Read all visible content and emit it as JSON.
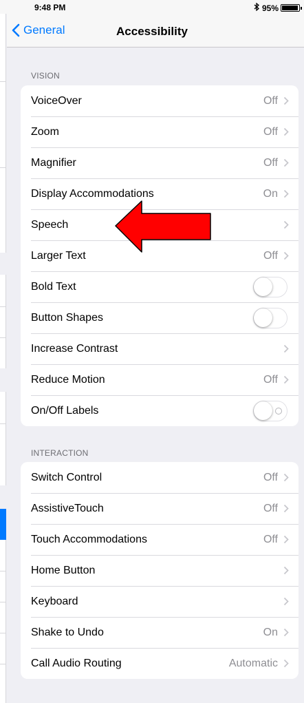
{
  "status_bar": {
    "time": "9:48 PM",
    "bluetooth_icon": "bluetooth-icon",
    "battery": "95%",
    "battery_level": 0.95
  },
  "nav": {
    "back_label": "General",
    "title": "Accessibility"
  },
  "vision": {
    "header": "VISION",
    "rows": [
      {
        "label": "VoiceOver",
        "value": "Off"
      },
      {
        "label": "Zoom",
        "value": "Off"
      },
      {
        "label": "Magnifier",
        "value": "Off"
      },
      {
        "label": "Display Accommodations",
        "value": "On"
      },
      {
        "label": "Speech",
        "value": ""
      },
      {
        "label": "Larger Text",
        "value": "Off"
      },
      {
        "label": "Bold Text",
        "toggle": false
      },
      {
        "label": "Button Shapes",
        "toggle": false
      },
      {
        "label": "Increase Contrast",
        "value": ""
      },
      {
        "label": "Reduce Motion",
        "value": "Off"
      },
      {
        "label": "On/Off Labels",
        "toggle": false
      }
    ]
  },
  "interaction": {
    "header": "INTERACTION",
    "rows": [
      {
        "label": "Switch Control",
        "value": "Off"
      },
      {
        "label": "AssistiveTouch",
        "value": "Off"
      },
      {
        "label": "Touch Accommodations",
        "value": "Off"
      },
      {
        "label": "Home Button",
        "value": ""
      },
      {
        "label": "Keyboard",
        "value": ""
      },
      {
        "label": "Shake to Undo",
        "value": "On"
      },
      {
        "label": "Call Audio Routing",
        "value": "Automatic"
      }
    ]
  },
  "colors": {
    "accent": "#007aff",
    "annotation_arrow": "#ff0000",
    "background": "#efeff4"
  }
}
